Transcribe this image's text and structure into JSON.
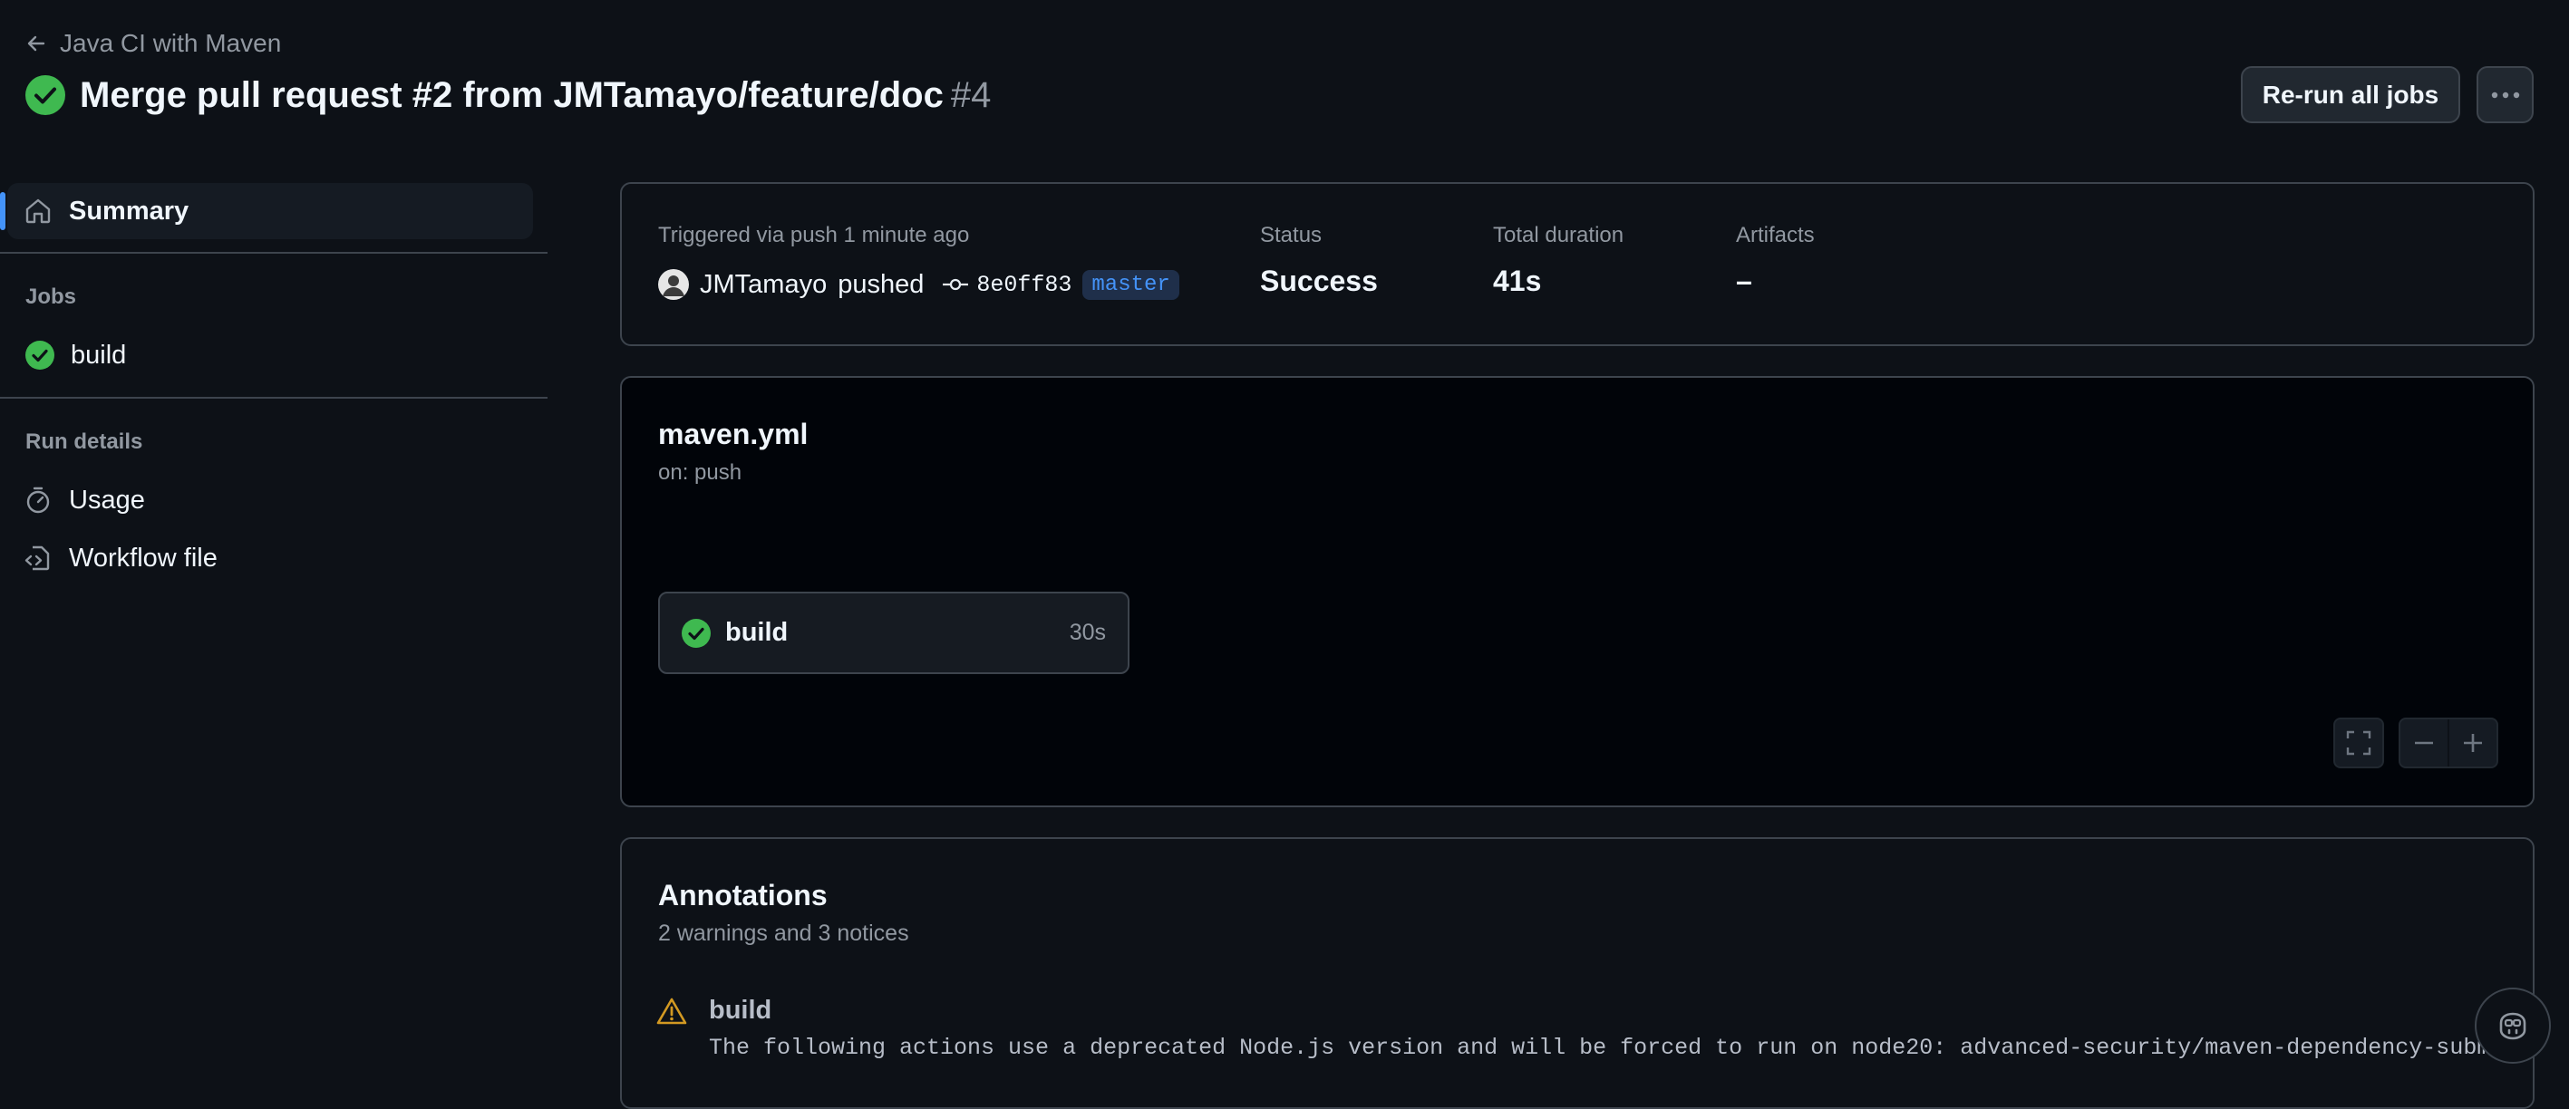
{
  "header": {
    "back_label": "Java CI with Maven",
    "title": "Merge pull request #2 from JMTamayo/feature/doc",
    "run_number": "#4",
    "rerun_label": "Re-run all jobs"
  },
  "sidebar": {
    "summary_label": "Summary",
    "jobs_heading": "Jobs",
    "jobs": [
      {
        "label": "build"
      }
    ],
    "run_details_heading": "Run details",
    "usage_label": "Usage",
    "workflow_file_label": "Workflow file"
  },
  "summary": {
    "triggered": "Triggered via push 1 minute ago",
    "actor": "JMTamayo",
    "action": "pushed",
    "commit": "8e0ff83",
    "branch": "master",
    "status_label": "Status",
    "status_value": "Success",
    "duration_label": "Total duration",
    "duration_value": "41s",
    "artifacts_label": "Artifacts",
    "artifacts_value": "–"
  },
  "workflow": {
    "name": "maven.yml",
    "trigger": "on: push",
    "job": {
      "name": "build",
      "duration": "30s"
    }
  },
  "annotations": {
    "title": "Annotations",
    "subtitle": "2 warnings and 3 notices",
    "items": [
      {
        "job": "build",
        "message": "The following actions use a deprecated Node.js version and will be forced to run on node20: advanced-security/maven-dependency-submi"
      }
    ]
  },
  "colors": {
    "background": "#0d1117",
    "success": "#3fb950",
    "accent": "#4493f8",
    "warning": "#d29922",
    "border": "#3d444d"
  }
}
